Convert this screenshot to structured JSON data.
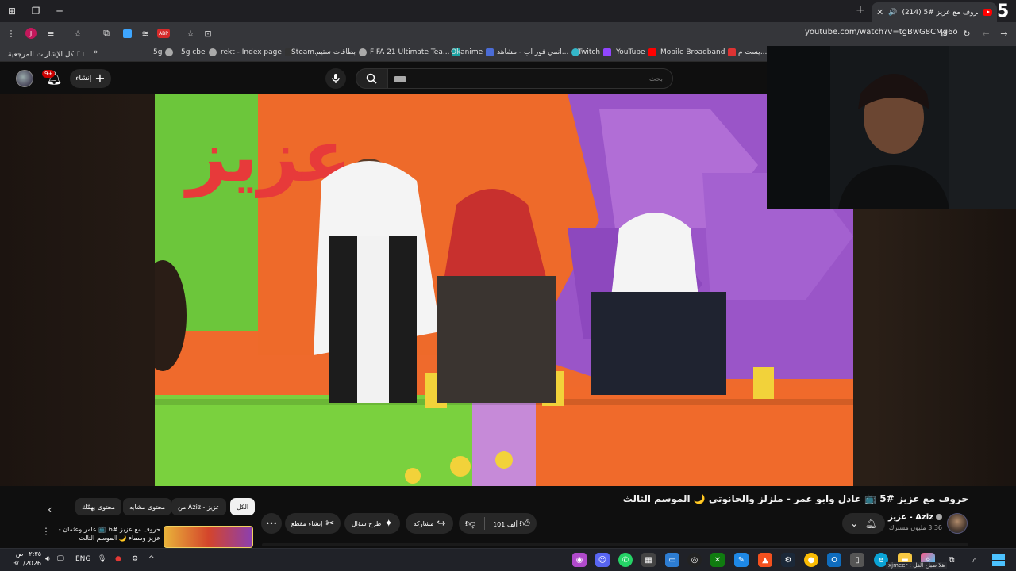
{
  "browser": {
    "tab_title": "(214) حروف مع عزيز #5 📺",
    "url": "youtube.com/watch?v=tgBwG8CMg6o",
    "profile_letter": "J",
    "corner_label": "5"
  },
  "bookmarks": {
    "all_bookmarks": "كل الإشارات المرجعية",
    "items": [
      "5g",
      "5g cbe",
      "rekt - Index page",
      "Steam...",
      "بطاقات ستيم",
      "FIFA 21 Ultimate Tea...",
      "Okanime",
      "انمي فور اب - مشاهد...",
      "Twitch",
      "YouTube",
      "Mobile Broadband",
      "يست م..."
    ]
  },
  "youtube_header": {
    "notif_count": "9+",
    "create_label": "إنشاء",
    "search_placeholder": "بحث"
  },
  "video": {
    "title": "حروف مع عزيز #5 📺 عادل وابو عمر - ملزلز والحانوتي 🌙 الموسم الثالث",
    "channel_name": "Aziz - عزيز",
    "subscribers": "3.36 مليون مشترك",
    "likes": "101 ألف",
    "share_label": "مشاركة",
    "ask_label": "طرح سؤال",
    "clip_label": "إنشاء مقطع"
  },
  "chips": {
    "all": "الكل",
    "from_channel": "من Aziz - عزيز",
    "similar": "محتوى مشابه",
    "for_you": "محتوى يهمّك"
  },
  "recommendation": {
    "title": "حروف مع عزيز #6 📺 عامر وعثمان - عزيز وسماء 🌙 الموسم الثالث"
  },
  "taskbar": {
    "time": "٠٢:٣٥ ص",
    "date": "3/1/2026",
    "lang": "ENG",
    "tooltip": "xjmeer : هلا صباح الفل"
  },
  "colors": {
    "accent_red": "#ff0000",
    "bg": "#0f0f0f",
    "chrome": "#35363a"
  }
}
